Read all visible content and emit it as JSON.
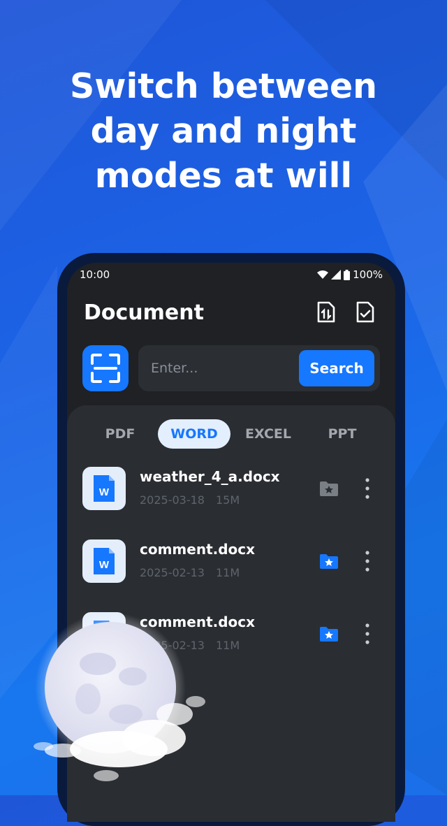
{
  "headline": [
    "Switch between",
    "day and night",
    "modes at will"
  ],
  "status_bar": {
    "time": "10:00",
    "battery": "100%"
  },
  "header": {
    "title": "Document",
    "icons": [
      "file-convert-icon",
      "file-check-icon"
    ]
  },
  "search": {
    "placeholder": "Enter...",
    "button_label": "Search",
    "scan_icon": "scan-icon"
  },
  "tabs": [
    {
      "label": "PDF",
      "active": false
    },
    {
      "label": "WORD",
      "active": true
    },
    {
      "label": "EXCEL",
      "active": false
    },
    {
      "label": "PPT",
      "active": false
    }
  ],
  "files": [
    {
      "name": "weather_4_a.docx",
      "date": "2025-03-18",
      "size": "15M",
      "favorited": false
    },
    {
      "name": "comment.docx",
      "date": "2025-02-13",
      "size": "11M",
      "favorited": true
    },
    {
      "name": "comment.docx",
      "date": "2025-02-13",
      "size": "11M",
      "favorited": true
    }
  ],
  "colors": {
    "accent": "#1677ff",
    "background": "#1c63e6",
    "screen": "#1f2124",
    "panel": "#2a2d32"
  }
}
